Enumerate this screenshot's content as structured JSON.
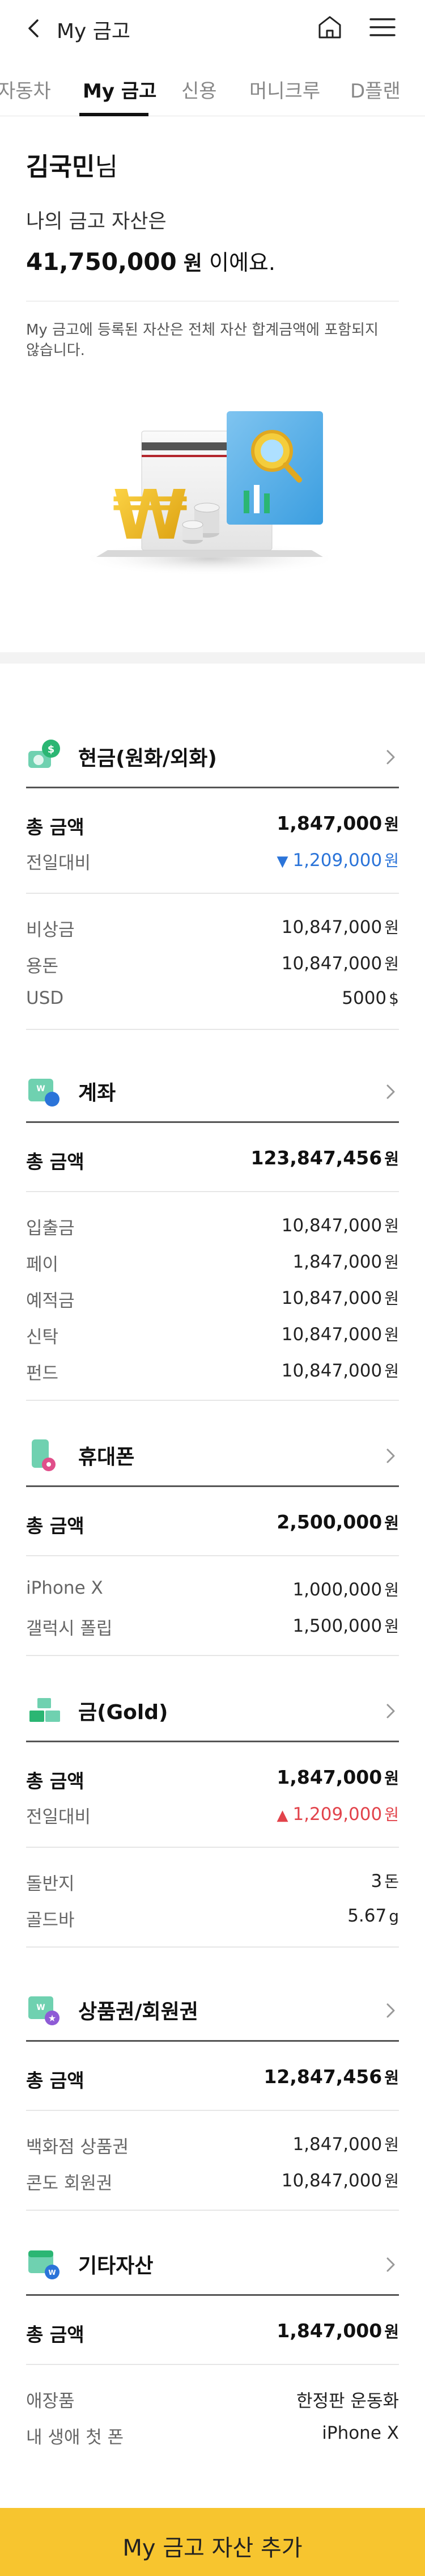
{
  "header": {
    "title": "My 금고"
  },
  "tabs": [
    {
      "label": "자동차",
      "active": false
    },
    {
      "label": "My 금고",
      "active": true
    },
    {
      "label": "신용",
      "active": false
    },
    {
      "label": "머니크루",
      "active": false
    },
    {
      "label": "D플랜",
      "active": false
    }
  ],
  "greeting": {
    "name": "김국민",
    "suffix": "님",
    "intro": "나의 금고 자산은",
    "total_value": "41,750,000",
    "total_unit": "원",
    "total_suffix": " 이에요.",
    "note": "My 금고에 등록된 자산은 전체 자산 합계금액에 포함되지 않습니다."
  },
  "categories": [
    {
      "title": "현금(원화/외화)",
      "icon": "cash-icon",
      "total_label": "총 금액",
      "total_value": "1,847,000",
      "total_unit": "원",
      "change": {
        "label": "전일대비",
        "direction": "down",
        "symbol": "▼",
        "value": "1,209,000",
        "unit": "원"
      },
      "items": [
        {
          "label": "비상금",
          "value": "10,847,000",
          "unit": "원"
        },
        {
          "label": "용돈",
          "value": "10,847,000",
          "unit": "원"
        },
        {
          "label": "USD",
          "value": "5000",
          "unit": "$"
        }
      ]
    },
    {
      "title": "계좌",
      "icon": "account-icon",
      "total_label": "총 금액",
      "total_value": "123,847,456",
      "total_unit": "원",
      "items": [
        {
          "label": "입출금",
          "value": "10,847,000",
          "unit": "원"
        },
        {
          "label": "페이",
          "value": "1,847,000",
          "unit": "원"
        },
        {
          "label": "예적금",
          "value": "10,847,000",
          "unit": "원"
        },
        {
          "label": "신탁",
          "value": "10,847,000",
          "unit": "원"
        },
        {
          "label": "펀드",
          "value": "10,847,000",
          "unit": "원"
        }
      ]
    },
    {
      "title": "휴대폰",
      "icon": "phone-icon",
      "total_label": "총 금액",
      "total_value": "2,500,000",
      "total_unit": "원",
      "items": [
        {
          "label": "iPhone X",
          "value": "1,000,000",
          "unit": "원"
        },
        {
          "label": "갤럭시 폴립",
          "value": "1,500,000",
          "unit": "원"
        }
      ]
    },
    {
      "title": "금(Gold)",
      "icon": "gold-icon",
      "total_label": "총 금액",
      "total_value": "1,847,000",
      "total_unit": "원",
      "change": {
        "label": "전일대비",
        "direction": "up",
        "symbol": "▲",
        "value": "1,209,000",
        "unit": "원"
      },
      "items": [
        {
          "label": "돌반지",
          "value": "3",
          "unit": "돈"
        },
        {
          "label": "골드바",
          "value": "5.67",
          "unit": "g"
        }
      ]
    },
    {
      "title": "상품권/회원권",
      "icon": "voucher-icon",
      "total_label": "총 금액",
      "total_value": "12,847,456",
      "total_unit": "원",
      "items": [
        {
          "label": "백화점 상품권",
          "value": "1,847,000",
          "unit": "원"
        },
        {
          "label": "콘도 회원권",
          "value": "10,847,000",
          "unit": "원"
        }
      ]
    },
    {
      "title": "기타자산",
      "icon": "etc-asset-icon",
      "total_label": "총 금액",
      "total_value": "1,847,000",
      "total_unit": "원",
      "items": [
        {
          "label": "애장품",
          "value": "한정판 운동화",
          "unit": ""
        },
        {
          "label": "내 생애 첫 폰",
          "value": "iPhone X",
          "unit": ""
        }
      ]
    }
  ],
  "cta": {
    "label": "My 금고 자산 추가"
  },
  "colors": {
    "accent": "#f7c52f",
    "down": "#2b74d9",
    "up": "#e2434b"
  }
}
